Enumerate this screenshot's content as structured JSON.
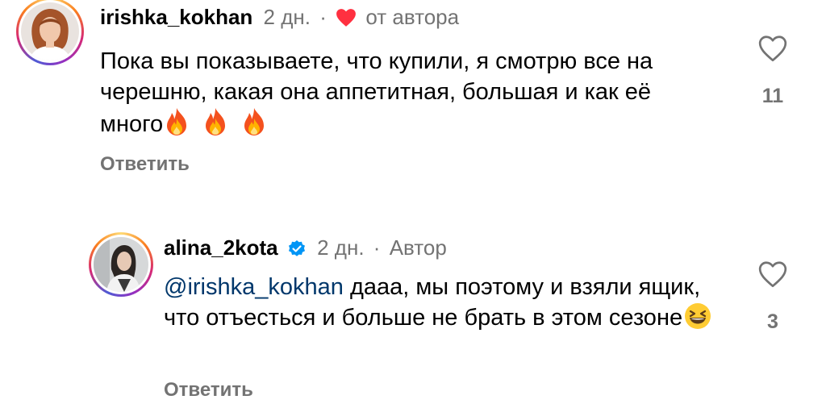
{
  "comments": [
    {
      "username": "irishka_kokhan",
      "time": "2 дн.",
      "separator": "·",
      "author_note": "от автора",
      "text": "Пока вы показываете, что купили, я смотрю все на черешню, какая она аппетитная, большая и как её много",
      "emojis": [
        "fire",
        "fire",
        "fire"
      ],
      "reply_label": "Ответить",
      "likes": "11",
      "liked_by_author": true
    },
    {
      "username": "alina_2kota",
      "verified": true,
      "time": "2 дн.",
      "separator": "·",
      "author_note": "Автор",
      "mention": "@irishka_kokhan",
      "text": " дааа, мы поэтому и взяли ящик, что отъесться и больше не брать в этом сезоне",
      "emojis": [
        "laughing-face"
      ],
      "reply_label": "Ответить",
      "likes": "3"
    }
  ],
  "colors": {
    "heart_red": "#ff3040",
    "verified_blue": "#0095f6",
    "mention_blue": "#00376b",
    "muted": "#737373"
  }
}
